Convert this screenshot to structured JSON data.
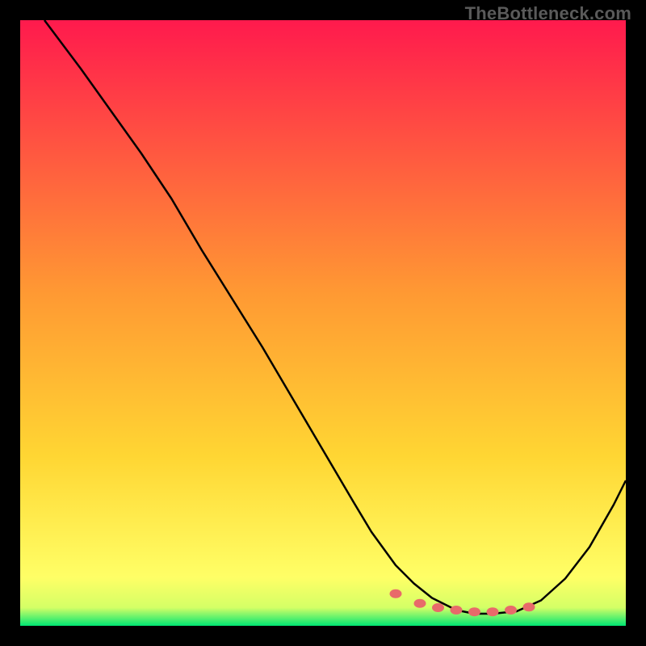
{
  "watermark": "TheBottleneck.com",
  "colors": {
    "background": "#000000",
    "gradient_top": "#ff1a4d",
    "gradient_mid": "#ffd633",
    "gradient_bottom": "#ffff66",
    "gradient_base": "#00e673",
    "curve": "#000000",
    "marker": "#e86a6a"
  },
  "chart_data": {
    "type": "line",
    "title": "",
    "xlabel": "",
    "ylabel": "",
    "xlim": [
      0,
      100
    ],
    "ylim": [
      0,
      100
    ],
    "curve": {
      "x": [
        4,
        10,
        15,
        20,
        25,
        30,
        35,
        40,
        45,
        50,
        55,
        58,
        62,
        65,
        68,
        72,
        75,
        78,
        82,
        86,
        90,
        94,
        98,
        100
      ],
      "y": [
        100,
        92,
        85,
        78,
        70.5,
        62,
        54,
        46,
        37.5,
        29,
        20.5,
        15.5,
        10,
        7,
        4.6,
        2.6,
        2.0,
        2.0,
        2.4,
        4.2,
        7.8,
        13.0,
        20.0,
        24.0
      ]
    },
    "markers": {
      "x": [
        62,
        66,
        69,
        72,
        75,
        78,
        81,
        84
      ],
      "y": [
        5.3,
        3.7,
        3.0,
        2.6,
        2.3,
        2.3,
        2.6,
        3.1
      ]
    }
  }
}
